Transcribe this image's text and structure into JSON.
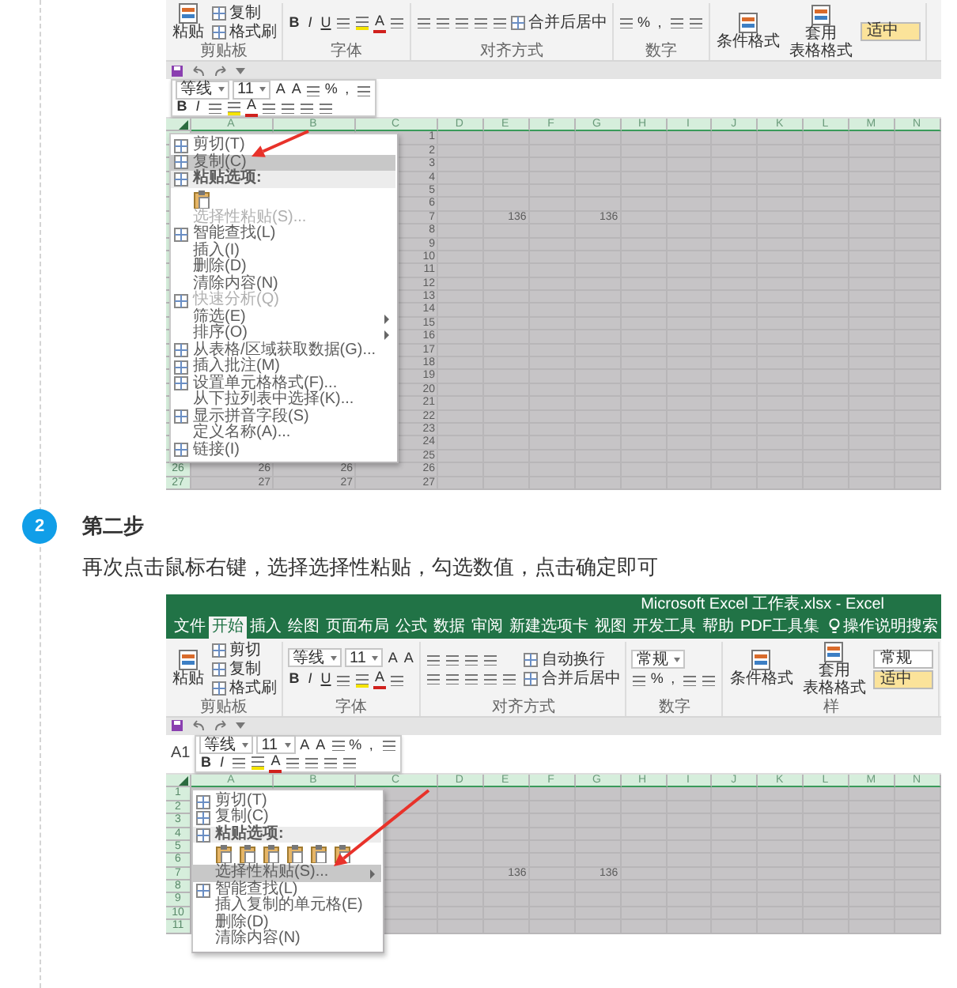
{
  "first_screenshot": {
    "ribbon": [
      {
        "label": "剪贴板",
        "cols": [
          [
            [
              {
                "kind": "large",
                "label": "粘贴"
              }
            ]
          ],
          [
            [
              {
                "kind": "small",
                "label": "复制"
              }
            ],
            [
              {
                "kind": "small",
                "label": "格式刷"
              }
            ]
          ]
        ]
      },
      {
        "label": "字体",
        "cols": [
          [
            [
              {
                "kind": "bold",
                "label": "B"
              },
              {
                "kind": "italic",
                "label": "I"
              },
              {
                "kind": "underline",
                "label": "U"
              },
              {
                "kind": "tool"
              },
              {
                "kind": "tool",
                "color": "#f5e400"
              },
              {
                "kind": "glyph",
                "label": "A",
                "color": "#d0201c"
              },
              {
                "kind": "tool"
              }
            ]
          ]
        ]
      },
      {
        "label": "对齐方式",
        "cols": [
          [
            [
              {
                "kind": "tool"
              },
              {
                "kind": "tool"
              },
              {
                "kind": "tool"
              },
              {
                "kind": "tool"
              },
              {
                "kind": "tool"
              },
              {
                "kind": "small",
                "label": "合并后居中"
              }
            ]
          ]
        ]
      },
      {
        "label": "数字",
        "cols": [
          [
            [
              {
                "kind": "tool"
              },
              {
                "kind": "glyph",
                "label": "%"
              },
              {
                "kind": "glyph",
                "label": ","
              },
              {
                "kind": "tool"
              },
              {
                "kind": "tool"
              }
            ]
          ]
        ]
      },
      {
        "cols": [
          [
            [
              {
                "kind": "large",
                "label": "条件格式"
              }
            ]
          ],
          [
            [
              {
                "kind": "large",
                "lines": [
                  "套用",
                  "表格格式"
                ]
              }
            ]
          ],
          [
            [
              {
                "kind": "style",
                "label": "适中",
                "color": "#fbe39a"
              }
            ]
          ]
        ]
      }
    ],
    "mini_toolbar": [
      [
        {
          "kind": "field",
          "label": "等线"
        },
        {
          "kind": "field",
          "label": "11"
        },
        {
          "kind": "glyph",
          "label": "A"
        },
        {
          "kind": "glyph",
          "label": "A"
        },
        {
          "kind": "tool"
        },
        {
          "kind": "glyph",
          "label": "%"
        },
        {
          "kind": "glyph",
          "label": ","
        },
        {
          "kind": "tool"
        }
      ],
      [
        {
          "kind": "bold",
          "label": "B"
        },
        {
          "kind": "italic",
          "label": "I"
        },
        {
          "kind": "tool"
        },
        {
          "kind": "tool",
          "color": "#f5e400"
        },
        {
          "kind": "glyph",
          "label": "A",
          "color": "#d0201c"
        },
        {
          "kind": "tool"
        },
        {
          "kind": "tool"
        },
        {
          "kind": "tool"
        },
        {
          "kind": "tool"
        }
      ]
    ],
    "columns": [
      "A",
      "B",
      "C",
      "D",
      "E",
      "F",
      "G",
      "H",
      "I",
      "J",
      "K",
      "L",
      "M",
      "N"
    ],
    "rows": [
      {
        "cells": [
          null,
          null,
          "1"
        ]
      },
      {
        "cells": [
          null,
          null,
          "2"
        ]
      },
      {
        "cells": [
          null,
          null,
          "3"
        ]
      },
      {
        "cells": [
          null,
          null,
          "4"
        ]
      },
      {
        "cells": [
          null,
          null,
          "5"
        ]
      },
      {
        "cells": [
          null,
          null,
          "6"
        ]
      },
      {
        "cells": [
          null,
          null,
          "7",
          null,
          "136",
          null,
          "136"
        ]
      },
      {
        "cells": [
          null,
          null,
          "8"
        ]
      },
      {
        "cells": [
          null,
          null,
          "9"
        ]
      },
      {
        "cells": [
          null,
          null,
          "10"
        ]
      },
      {
        "cells": [
          null,
          null,
          "11"
        ]
      },
      {
        "cells": [
          null,
          null,
          "12"
        ]
      },
      {
        "cells": [
          null,
          null,
          "13"
        ]
      },
      {
        "cells": [
          null,
          null,
          "14"
        ]
      },
      {
        "cells": [
          null,
          null,
          "15"
        ]
      },
      {
        "cells": [
          null,
          null,
          "16"
        ]
      },
      {
        "cells": [
          null,
          null,
          "17"
        ]
      },
      {
        "cells": [
          null,
          null,
          "18"
        ]
      },
      {
        "cells": [
          null,
          null,
          "19"
        ]
      },
      {
        "cells": [
          null,
          null,
          "20"
        ]
      },
      {
        "cells": [
          null,
          null,
          "21"
        ]
      },
      {
        "cells": [
          null,
          null,
          "22"
        ]
      },
      {
        "cells": [
          null,
          null,
          "23"
        ]
      },
      {
        "cells": [
          null,
          null,
          "24"
        ]
      },
      {
        "cells": [
          null,
          null,
          "25"
        ]
      },
      {
        "number": "26",
        "cells": [
          "26",
          "26",
          "26"
        ]
      },
      {
        "number": "27",
        "cells": [
          "27",
          "27",
          "27"
        ]
      }
    ],
    "context_menu": [
      {
        "kind": "iconed",
        "label": "剪切(T)",
        "selected": false,
        "disabled": false,
        "submenu": false
      },
      {
        "kind": "iconed",
        "label": "复制(C)",
        "selected": true,
        "disabled": false,
        "submenu": false
      },
      {
        "kind": "heading",
        "label": "粘贴选项:",
        "selected": false,
        "disabled": false,
        "submenu": false
      },
      {
        "kind": "options",
        "options": [
          {
            "kind": "paste"
          }
        ],
        "selected": false,
        "disabled": false,
        "submenu": false
      },
      {
        "kind": "plain",
        "label": "选择性粘贴(S)...",
        "selected": false,
        "disabled": true,
        "submenu": false
      },
      {
        "kind": "iconed",
        "label": "智能查找(L)",
        "selected": false,
        "disabled": false,
        "submenu": false
      },
      {
        "kind": "plain",
        "label": "插入(I)",
        "selected": false,
        "disabled": false,
        "submenu": false
      },
      {
        "kind": "plain",
        "label": "删除(D)",
        "selected": false,
        "disabled": false,
        "submenu": false
      },
      {
        "kind": "plain",
        "label": "清除内容(N)",
        "selected": false,
        "disabled": false,
        "submenu": false
      },
      {
        "kind": "iconed",
        "label": "快速分析(Q)",
        "selected": false,
        "disabled": true,
        "submenu": false
      },
      {
        "kind": "plain",
        "label": "筛选(E)",
        "selected": false,
        "disabled": false,
        "submenu": true
      },
      {
        "kind": "plain",
        "label": "排序(O)",
        "selected": false,
        "disabled": false,
        "submenu": true
      },
      {
        "kind": "iconed",
        "label": "从表格/区域获取数据(G)...",
        "selected": false,
        "disabled": false,
        "submenu": false
      },
      {
        "kind": "iconed",
        "label": "插入批注(M)",
        "selected": false,
        "disabled": false,
        "submenu": false
      },
      {
        "kind": "iconed",
        "label": "设置单元格格式(F)...",
        "selected": false,
        "disabled": false,
        "submenu": false
      },
      {
        "kind": "plain",
        "label": "从下拉列表中选择(K)...",
        "selected": false,
        "disabled": false,
        "submenu": false
      },
      {
        "kind": "iconed",
        "label": "显示拼音字段(S)",
        "selected": false,
        "disabled": false,
        "submenu": false
      },
      {
        "kind": "plain",
        "label": "定义名称(A)...",
        "selected": false,
        "disabled": false,
        "submenu": false
      },
      {
        "kind": "iconed",
        "label": "链接(I)",
        "selected": false,
        "disabled": false,
        "submenu": false
      }
    ]
  },
  "step": {
    "number": "2",
    "title": "第二步",
    "text": "再次点击鼠标右键，选择选择性粘贴，勾选数值，点击确定即可"
  },
  "second_screenshot": {
    "title": "Microsoft Excel 工作表.xlsx - Excel",
    "tabs": [
      {
        "label": "文件",
        "selected": false
      },
      {
        "label": "开始",
        "selected": true
      },
      {
        "label": "插入",
        "selected": false
      },
      {
        "label": "绘图",
        "selected": false
      },
      {
        "label": "页面布局",
        "selected": false
      },
      {
        "label": "公式",
        "selected": false
      },
      {
        "label": "数据",
        "selected": false
      },
      {
        "label": "审阅",
        "selected": false
      },
      {
        "label": "新建选项卡",
        "selected": false
      },
      {
        "label": "视图",
        "selected": false
      },
      {
        "label": "开发工具",
        "selected": false
      },
      {
        "label": "帮助",
        "selected": false
      },
      {
        "label": "PDF工具集",
        "selected": false
      }
    ],
    "tell_me": "操作说明搜索",
    "ribbon": [
      {
        "label": "剪贴板",
        "cols": [
          [
            [
              {
                "kind": "large",
                "label": "粘贴"
              }
            ]
          ],
          [
            [
              {
                "kind": "small",
                "label": "剪切"
              }
            ],
            [
              {
                "kind": "small",
                "label": "复制"
              }
            ],
            [
              {
                "kind": "small",
                "label": "格式刷"
              }
            ]
          ]
        ]
      },
      {
        "label": "字体",
        "cols": [
          [
            [
              {
                "kind": "field",
                "label": "等线"
              },
              {
                "kind": "field",
                "label": "11"
              },
              {
                "kind": "glyph",
                "label": "A"
              },
              {
                "kind": "glyph",
                "label": "A"
              }
            ],
            [
              {
                "kind": "bold",
                "label": "B"
              },
              {
                "kind": "italic",
                "label": "I"
              },
              {
                "kind": "underline",
                "label": "U"
              },
              {
                "kind": "tool"
              },
              {
                "kind": "tool",
                "color": "#f5e400"
              },
              {
                "kind": "glyph",
                "label": "A",
                "color": "#d0201c"
              },
              {
                "kind": "tool"
              }
            ]
          ]
        ]
      },
      {
        "label": "对齐方式",
        "cols": [
          [
            [
              {
                "kind": "tool"
              },
              {
                "kind": "tool"
              },
              {
                "kind": "tool"
              },
              {
                "kind": "tool"
              }
            ],
            [
              {
                "kind": "tool"
              },
              {
                "kind": "tool"
              },
              {
                "kind": "tool"
              },
              {
                "kind": "tool"
              },
              {
                "kind": "tool"
              }
            ]
          ],
          [
            [
              {
                "kind": "small",
                "label": "自动换行"
              }
            ],
            [
              {
                "kind": "small",
                "label": "合并后居中"
              }
            ]
          ]
        ]
      },
      {
        "label": "数字",
        "cols": [
          [
            [
              {
                "kind": "field",
                "label": "常规"
              }
            ],
            [
              {
                "kind": "tool"
              },
              {
                "kind": "glyph",
                "label": "%"
              },
              {
                "kind": "glyph",
                "label": ","
              },
              {
                "kind": "tool"
              },
              {
                "kind": "tool"
              }
            ]
          ]
        ]
      },
      {
        "label": "样",
        "cols": [
          [
            [
              {
                "kind": "large",
                "label": "条件格式"
              }
            ]
          ],
          [
            [
              {
                "kind": "large",
                "lines": [
                  "套用",
                  "表格格式"
                ]
              }
            ]
          ],
          [
            [
              {
                "kind": "style",
                "label": "常规",
                "color": "#ffffff"
              }
            ],
            [
              {
                "kind": "style",
                "label": "适中",
                "color": "#fbe39a"
              }
            ]
          ]
        ]
      }
    ],
    "name_box": "A1",
    "mini_toolbar": [
      [
        {
          "kind": "field",
          "label": "等线"
        },
        {
          "kind": "field",
          "label": "11"
        },
        {
          "kind": "glyph",
          "label": "A"
        },
        {
          "kind": "glyph",
          "label": "A"
        },
        {
          "kind": "tool"
        },
        {
          "kind": "glyph",
          "label": "%"
        },
        {
          "kind": "glyph",
          "label": ","
        },
        {
          "kind": "tool"
        }
      ],
      [
        {
          "kind": "bold",
          "label": "B"
        },
        {
          "kind": "italic",
          "label": "I"
        },
        {
          "kind": "tool"
        },
        {
          "kind": "tool",
          "color": "#f5e400"
        },
        {
          "kind": "glyph",
          "label": "A",
          "color": "#d0201c"
        },
        {
          "kind": "tool"
        },
        {
          "kind": "tool"
        },
        {
          "kind": "tool"
        },
        {
          "kind": "tool"
        }
      ]
    ],
    "columns": [
      "A",
      "B",
      "C",
      "D",
      "E",
      "F",
      "G",
      "H",
      "I",
      "J",
      "K",
      "L",
      "M",
      "N"
    ],
    "rows": [
      {
        "number": "1"
      },
      {
        "number": "2"
      },
      {
        "number": "3"
      },
      {
        "number": "4"
      },
      {
        "number": "5"
      },
      {
        "number": "6"
      },
      {
        "number": "7",
        "cells": [
          null,
          null,
          null,
          null,
          "136",
          null,
          "136"
        ]
      },
      {
        "number": "8"
      },
      {
        "number": "9"
      },
      {
        "number": "10"
      },
      {
        "number": "11"
      }
    ],
    "context_menu": [
      {
        "kind": "iconed",
        "label": "剪切(T)",
        "selected": false,
        "disabled": false,
        "submenu": false
      },
      {
        "kind": "iconed",
        "label": "复制(C)",
        "selected": false,
        "disabled": false,
        "submenu": false
      },
      {
        "kind": "heading",
        "label": "粘贴选项:",
        "selected": false,
        "disabled": false,
        "submenu": false
      },
      {
        "kind": "options",
        "options": [
          {
            "kind": "paste"
          },
          {
            "kind": "paste"
          },
          {
            "kind": "paste"
          },
          {
            "kind": "paste"
          },
          {
            "kind": "paste"
          },
          {
            "kind": "paste"
          }
        ],
        "selected": false,
        "disabled": false,
        "submenu": false
      },
      {
        "kind": "plain",
        "label": "选择性粘贴(S)...",
        "selected": true,
        "disabled": false,
        "submenu": true
      },
      {
        "kind": "iconed",
        "label": "智能查找(L)",
        "selected": false,
        "disabled": false,
        "submenu": false
      },
      {
        "kind": "plain",
        "label": "插入复制的单元格(E)",
        "selected": false,
        "disabled": false,
        "submenu": false
      },
      {
        "kind": "plain",
        "label": "删除(D)",
        "selected": false,
        "disabled": false,
        "submenu": false
      },
      {
        "kind": "plain",
        "label": "清除内容(N)",
        "selected": false,
        "disabled": false,
        "submenu": false
      }
    ]
  }
}
